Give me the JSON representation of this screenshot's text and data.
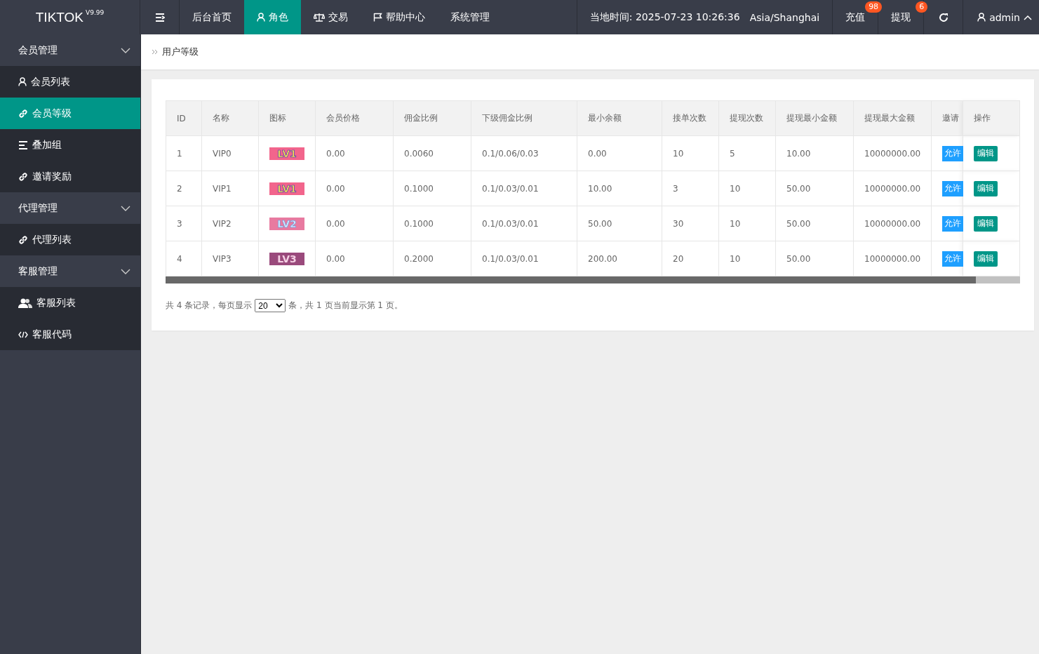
{
  "header": {
    "logo": "TIKTOK",
    "version": "V9.99",
    "nav": [
      {
        "label": "后台首页",
        "selected": false
      },
      {
        "label": "角色",
        "selected": true
      },
      {
        "label": "交易",
        "selected": false
      },
      {
        "label": "帮助中心",
        "selected": false
      },
      {
        "label": "系统管理",
        "selected": false
      }
    ],
    "time_label": "当地时间: 2025-07-23 10:26:36",
    "timezone": "Asia/Shanghai",
    "actions": [
      {
        "label": "充值",
        "count": "98"
      },
      {
        "label": "提现",
        "count": "6"
      }
    ],
    "user": "admin"
  },
  "sidebar": [
    {
      "label": "会员管理",
      "expanded": true,
      "children": [
        {
          "label": "会员列表",
          "selected": false
        },
        {
          "label": "会员等级",
          "selected": true
        },
        {
          "label": "叠加组",
          "selected": false
        },
        {
          "label": "邀请奖励",
          "selected": false
        }
      ]
    },
    {
      "label": "代理管理",
      "expanded": true,
      "children": [
        {
          "label": "代理列表",
          "selected": false
        }
      ]
    },
    {
      "label": "客服管理",
      "expanded": true,
      "children": [
        {
          "label": "客服列表",
          "selected": false
        },
        {
          "label": "客服代码",
          "selected": false
        }
      ]
    }
  ],
  "breadcrumb": "用户等级",
  "table": {
    "columns": [
      "ID",
      "名称",
      "图标",
      "会员价格",
      "佣金比例",
      "下级佣金比例",
      "最小余额",
      "接单次数",
      "提现次数",
      "提现最小金额",
      "提现最大金额",
      "邀请",
      "操作"
    ],
    "rows": [
      {
        "cells": [
          "1",
          "VIP0",
          "LV1",
          "0.00",
          "0.0060",
          "0.1/0.06/0.03",
          "0.00",
          "10",
          "5",
          "10.00",
          "10000000.00",
          "允许",
          "编辑"
        ],
        "color": "#f2658c"
      },
      {
        "cells": [
          "2",
          "VIP1",
          "LV1",
          "0.00",
          "0.1000",
          "0.1/0.03/0.01",
          "10.00",
          "3",
          "10",
          "50.00",
          "10000000.00",
          "允许",
          "编辑"
        ],
        "color": "#f2658c"
      },
      {
        "cells": [
          "3",
          "VIP2",
          "LV2",
          "0.00",
          "0.1000",
          "0.1/0.03/0.01",
          "50.00",
          "30",
          "10",
          "50.00",
          "10000000.00",
          "允许",
          "编辑"
        ],
        "color": "#e87aa0"
      },
      {
        "cells": [
          "4",
          "VIP3",
          "LV3",
          "0.00",
          "0.2000",
          "0.1/0.03/0.01",
          "200.00",
          "20",
          "10",
          "50.00",
          "10000000.00",
          "允许",
          "编辑"
        ],
        "color": "#9a4a7c"
      }
    ]
  },
  "pagination": {
    "before": "共 4 条记录，每页显示",
    "page_size": "20",
    "after": "条，共 1 页当前显示第 1 页。"
  }
}
